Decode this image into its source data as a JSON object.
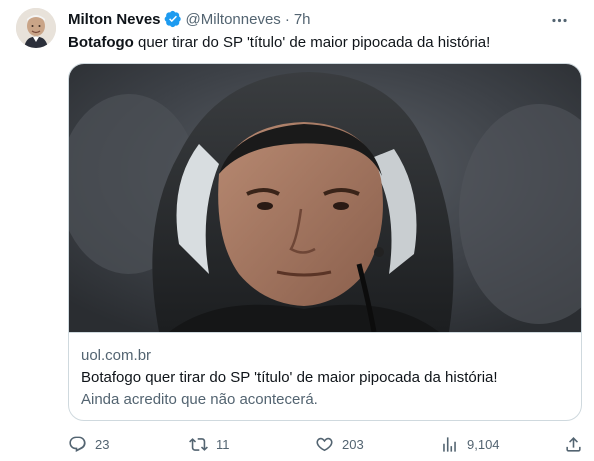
{
  "author": {
    "name": "Milton Neves",
    "handle": "@Miltonneves",
    "separator": "·",
    "time": "7h"
  },
  "tweet": {
    "text_bold": "Botafogo",
    "text_rest": " quer tirar do SP 'título' de maior pipocada da história!"
  },
  "card": {
    "domain": "uol.com.br",
    "title": "Botafogo quer tirar do SP 'título' de maior pipocada da história!",
    "description": "Ainda acredito que não acontecerá."
  },
  "actions": {
    "replies": "23",
    "retweets": "11",
    "likes": "203",
    "views": "9,104"
  },
  "colors": {
    "text": "#0f1419",
    "muted": "#536471",
    "verified": "#1d9bf0",
    "border": "#cfd9de"
  },
  "icons": [
    "verified-badge-icon",
    "more-icon",
    "reply-icon",
    "retweet-icon",
    "like-icon",
    "views-icon",
    "share-icon"
  ]
}
